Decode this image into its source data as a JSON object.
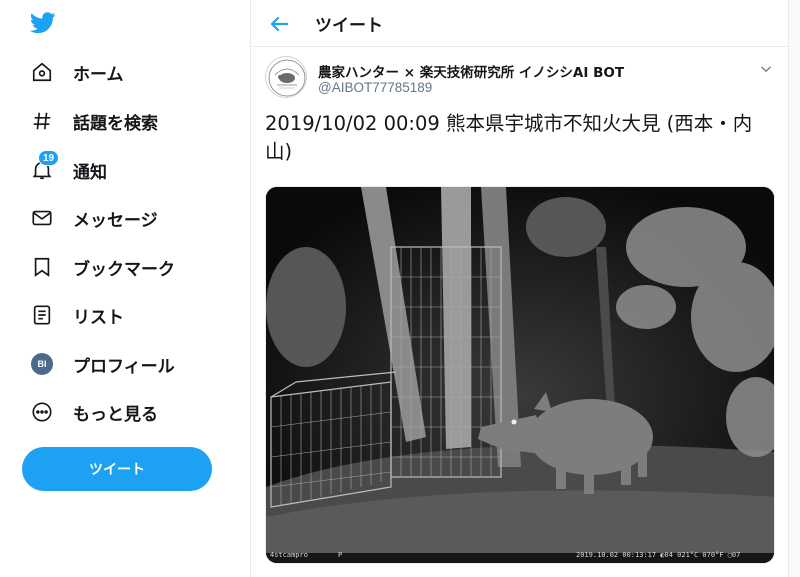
{
  "sidebar": {
    "logo": "twitter-bird-icon",
    "items": [
      {
        "label": "ホーム",
        "icon": "home-icon"
      },
      {
        "label": "話題を検索",
        "icon": "hashtag-icon"
      },
      {
        "label": "通知",
        "icon": "bell-icon",
        "badge": "19"
      },
      {
        "label": "メッセージ",
        "icon": "envelope-icon"
      },
      {
        "label": "ブックマーク",
        "icon": "bookmark-icon"
      },
      {
        "label": "リスト",
        "icon": "list-icon"
      },
      {
        "label": "プロフィール",
        "icon": "avatar",
        "avatar_text": "BI"
      },
      {
        "label": "もっと見る",
        "icon": "more-dots-icon"
      }
    ],
    "tweet_button": "ツイート"
  },
  "header": {
    "title": "ツイート",
    "back_icon": "back-arrow-icon"
  },
  "tweet": {
    "author_name": "農家ハンター × 楽天技術研究所 イノシシAI BOT",
    "author_handle": "@AIBOT77785189",
    "text": "2019/10/02 00:09 熊本県宇城市不知火大見 (西本・内山)",
    "photo": {
      "stamp_left": "4stcampro",
      "stamp_mid": "P",
      "stamp_right": "2019.10.02 00:13:17  ◐04  021°C 070°F  ▢07"
    }
  },
  "colors": {
    "accent": "#1da1f2",
    "text": "#14171a",
    "secondary": "#657786",
    "border": "#e6ecf0"
  }
}
